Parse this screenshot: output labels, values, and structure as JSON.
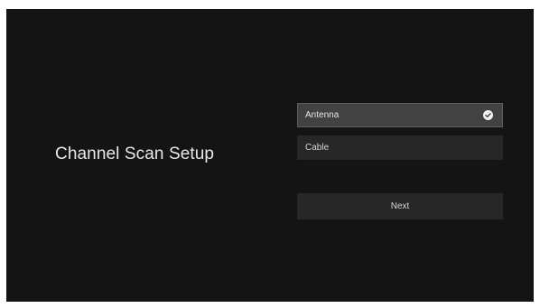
{
  "page": {
    "title": "Channel Scan Setup"
  },
  "options": [
    {
      "label": "Antenna",
      "selected": true,
      "icon": "check-circle-icon"
    },
    {
      "label": "Cable",
      "selected": false
    }
  ],
  "actions": {
    "next_label": "Next"
  },
  "colors": {
    "background": "#141414",
    "option_bg": "#272727",
    "selected_bg": "#424242",
    "text": "#e8e8e8"
  }
}
